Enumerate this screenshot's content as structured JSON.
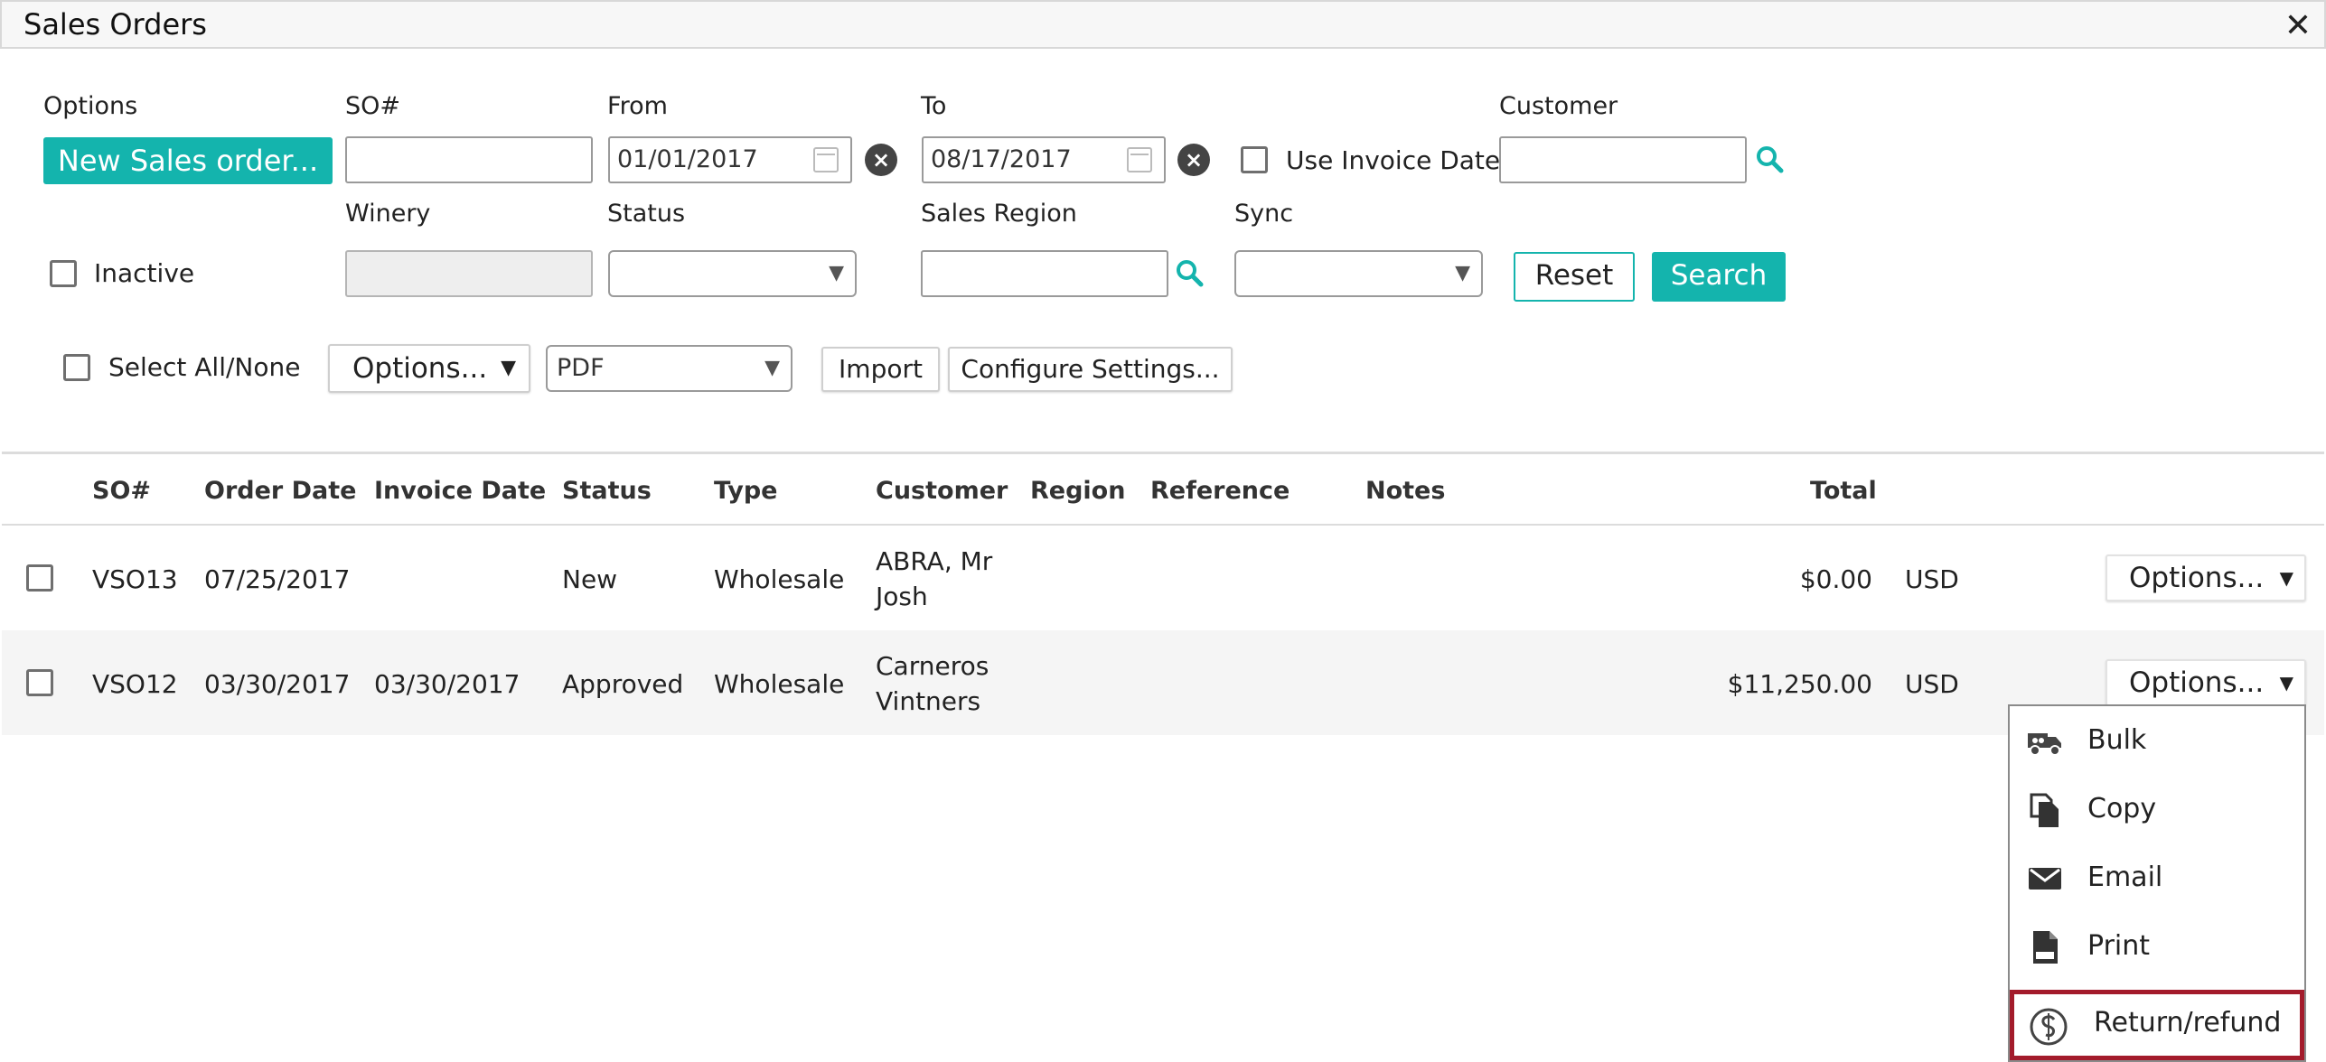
{
  "window": {
    "title": "Sales Orders",
    "close_glyph": "✕"
  },
  "filters": {
    "options_label": "Options",
    "new_order_label": "New Sales order...",
    "so_label": "SO#",
    "so_value": "",
    "from_label": "From",
    "from_value": "01/01/2017",
    "to_label": "To",
    "to_value": "08/17/2017",
    "use_invoice_date_label": "Use Invoice Date",
    "customer_label": "Customer",
    "customer_value": "",
    "inactive_label": "Inactive",
    "winery_label": "Winery",
    "status_label": "Status",
    "status_value": "",
    "sales_region_label": "Sales Region",
    "sync_label": "Sync",
    "sync_value": "",
    "reset_label": "Reset",
    "search_label": "Search"
  },
  "toolbar": {
    "select_all_label": "Select All/None",
    "options_label": "Options...",
    "format_value": "PDF",
    "import_label": "Import",
    "configure_label": "Configure Settings..."
  },
  "table": {
    "headers": {
      "so": "SO#",
      "order_date": "Order Date",
      "invoice_date": "Invoice Date",
      "status": "Status",
      "type": "Type",
      "customer": "Customer",
      "region": "Region",
      "reference": "Reference",
      "notes": "Notes",
      "total": "Total"
    },
    "rows": [
      {
        "so": "VSO13",
        "order_date": "07/25/2017",
        "invoice_date": "",
        "status": "New",
        "type": "Wholesale",
        "customer_line1": "ABRA, Mr",
        "customer_line2": "Josh",
        "total": "$0.00",
        "currency": "USD",
        "options_label": "Options..."
      },
      {
        "so": "VSO12",
        "order_date": "03/30/2017",
        "invoice_date": "03/30/2017",
        "status": "Approved",
        "type": "Wholesale",
        "customer_line1": "Carneros",
        "customer_line2": "Vintners",
        "total": "$11,250.00",
        "currency": "USD",
        "options_label": "Options..."
      }
    ]
  },
  "dropdown": {
    "items": [
      {
        "label": "Bulk",
        "icon": "truck-icon"
      },
      {
        "label": "Copy",
        "icon": "copy-icon"
      },
      {
        "label": "Email",
        "icon": "envelope-icon"
      },
      {
        "label": "Print",
        "icon": "pdf-file-icon"
      },
      {
        "label": "Return/refund",
        "icon": "refund-dollar-icon"
      }
    ],
    "highlight_color": "#a31b2b"
  },
  "colors": {
    "accent": "#14b4ad",
    "row_alt": "#f5f5f5"
  }
}
